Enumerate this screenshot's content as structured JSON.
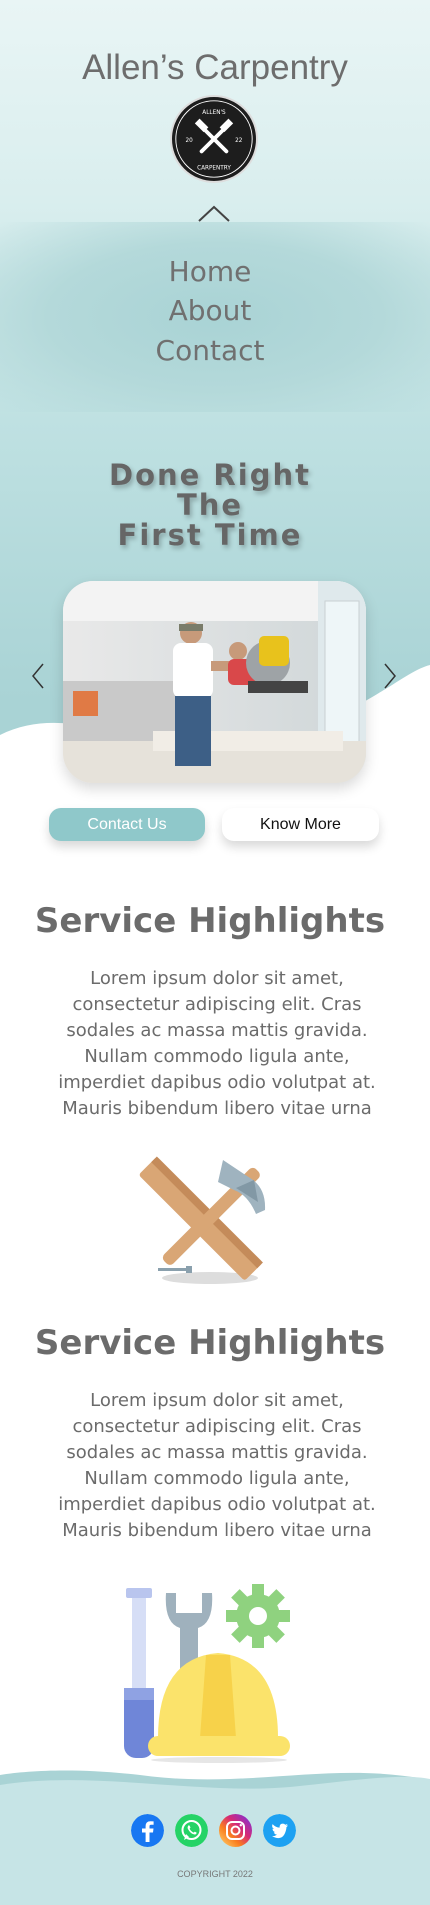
{
  "header": {
    "site_title": "Allen’s Carpentry",
    "logo_label": "Allen's Carpentry 2022 logo"
  },
  "logo_text": {
    "top": "ALLEN'S",
    "bottom": "CARPENTRY",
    "year_left": "20",
    "year_right": "22"
  },
  "nav": {
    "items": [
      {
        "label": "Home"
      },
      {
        "label": "About"
      },
      {
        "label": "Contact"
      }
    ]
  },
  "hero": {
    "line1": "Done Right",
    "line2": "The",
    "line3": "First Time"
  },
  "buttons": {
    "contact": "Contact Us",
    "more": "Know More"
  },
  "sections": [
    {
      "title": "Service Highlights",
      "body": "Lorem ipsum dolor sit amet, consectetur adipiscing elit. Cras sodales ac massa mattis gravida. Nullam commodo ligula ante, imperdiet dapibus odio volutpat at. Mauris bibendum libero vitae urna"
    },
    {
      "title": "Service Highlights",
      "body": "Lorem ipsum dolor sit amet, consectetur adipiscing elit. Cras sodales ac massa mattis gravida. Nullam commodo ligula ante, imperdiet dapibus odio volutpat at. Mauris bibendum libero vitae urna"
    }
  ],
  "social": [
    {
      "name": "facebook-icon",
      "color": "#1877f2"
    },
    {
      "name": "whatsapp-icon",
      "color": "#25d366"
    },
    {
      "name": "instagram-icon",
      "color": "#d62976"
    },
    {
      "name": "twitter-icon",
      "color": "#1da1f2"
    }
  ],
  "footer": {
    "copyright": "COPYRIGHT 2022"
  },
  "colors": {
    "accent": "#8fc8ca",
    "text": "#6b6b6b",
    "background": "#d9eeee"
  }
}
